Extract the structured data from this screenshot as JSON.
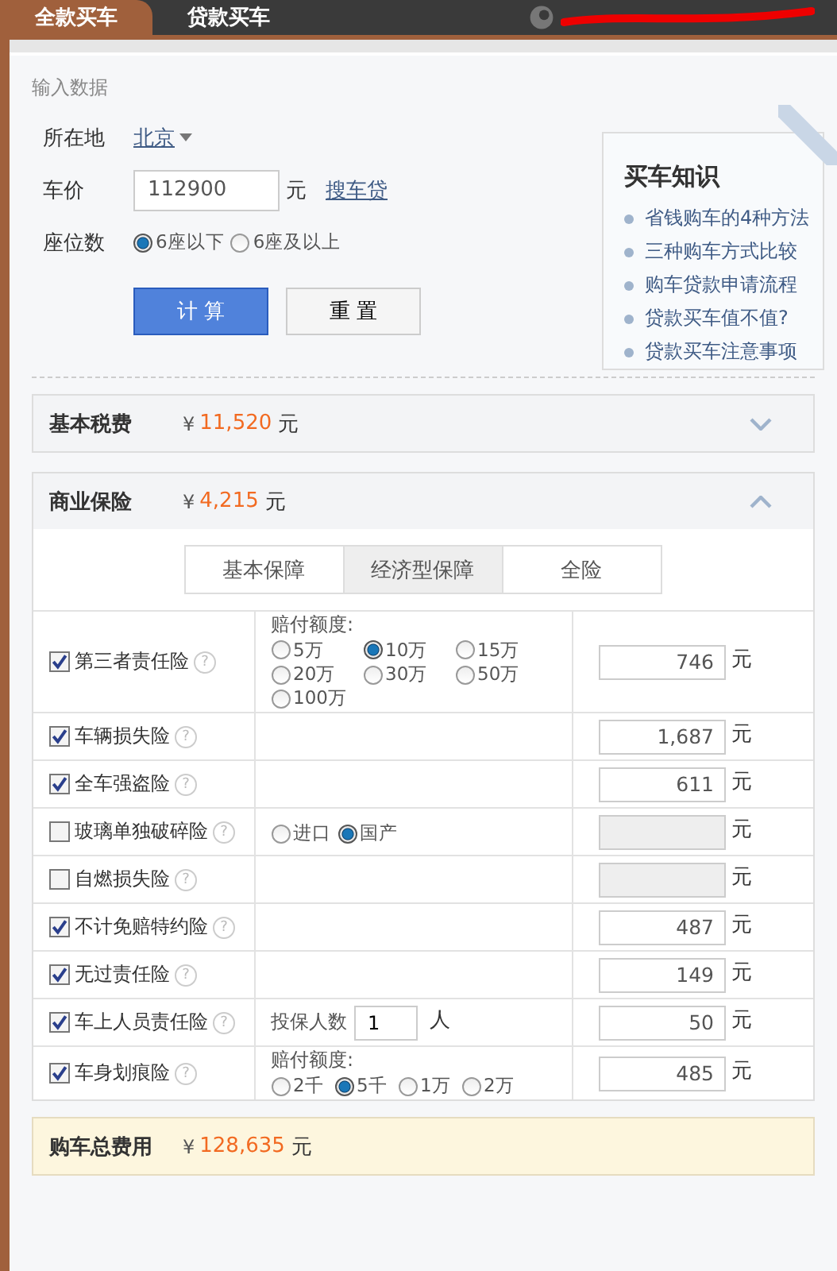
{
  "tabs": [
    {
      "label": "全款买车",
      "selected": true
    },
    {
      "label": "贷款买车",
      "selected": false
    }
  ],
  "input": {
    "section_label": "输入数据",
    "location": {
      "label": "所在地",
      "value": "北京"
    },
    "price": {
      "label": "车价",
      "value": "112900",
      "unit": "元",
      "link": "搜车贷"
    },
    "seats": {
      "label": "座位数",
      "options": [
        {
          "label": "6座以下",
          "selected": true
        },
        {
          "label": "6座及以上",
          "selected": false
        }
      ]
    },
    "buttons": [
      {
        "label": "计 算",
        "kind": "primary"
      },
      {
        "label": "重 置",
        "kind": "secondary"
      }
    ]
  },
  "knowledge": {
    "title": "买车知识",
    "items": [
      "省钱购车的4种方法",
      "三种购车方式比较",
      "购车贷款申请流程",
      "贷款买车值不值?",
      "贷款买车注意事项"
    ]
  },
  "sections": [
    {
      "title": "基本税费",
      "currency": "¥",
      "amount": "11,520",
      "unit": "元",
      "expanded": false
    },
    {
      "title": "商业保险",
      "currency": "¥",
      "amount": "4,215",
      "unit": "元",
      "expanded": true
    }
  ],
  "insurance_tabs": [
    {
      "label": "基本保障",
      "selected": false
    },
    {
      "label": "经济型保障",
      "selected": true
    },
    {
      "label": "全险",
      "selected": false
    }
  ],
  "insurance_rows": [
    {
      "name": "第三者责任险",
      "help": "?",
      "checked": true,
      "detail": {
        "kind": "radios",
        "label": "赔付额度:",
        "options": [
          {
            "label": "5万",
            "selected": false
          },
          {
            "label": "10万",
            "selected": true
          },
          {
            "label": "15万",
            "selected": false
          },
          {
            "label": "20万",
            "selected": false
          },
          {
            "label": "30万",
            "selected": false
          },
          {
            "label": "50万",
            "selected": false
          },
          {
            "label": "100万",
            "selected": false
          }
        ]
      },
      "amount": "746",
      "unit": "元"
    },
    {
      "name": "车辆损失险",
      "help": "?",
      "checked": true,
      "amount": "1,687",
      "unit": "元"
    },
    {
      "name": "全车强盗险",
      "help": "?",
      "checked": true,
      "amount": "611",
      "unit": "元"
    },
    {
      "name": "玻璃单独破碎险",
      "help": "?",
      "checked": false,
      "detail": {
        "kind": "radios",
        "options": [
          {
            "label": "进口",
            "selected": false
          },
          {
            "label": "国产",
            "selected": true
          }
        ]
      },
      "unit": "元"
    },
    {
      "name": "自燃损失险",
      "help": "?",
      "checked": false,
      "unit": "元"
    },
    {
      "name": "不计免赔特约险",
      "help": "?",
      "checked": true,
      "amount": "487",
      "unit": "元"
    },
    {
      "name": "无过责任险",
      "help": "?",
      "checked": true,
      "amount": "149",
      "unit": "元"
    },
    {
      "name": "车上人员责任险",
      "help": "?",
      "checked": true,
      "detail": {
        "kind": "count",
        "label": "投保人数",
        "value": "1",
        "unit": "人"
      },
      "amount": "50",
      "unit": "元"
    },
    {
      "name": "车身划痕险",
      "help": "?",
      "checked": true,
      "detail": {
        "kind": "radios",
        "label": "赔付额度:",
        "options": [
          {
            "label": "2千",
            "selected": false
          },
          {
            "label": "5千",
            "selected": true
          },
          {
            "label": "1万",
            "selected": false
          },
          {
            "label": "2万",
            "selected": false
          }
        ]
      },
      "amount": "485",
      "unit": "元"
    }
  ],
  "total": {
    "label": "购车总费用",
    "currency": "¥",
    "amount": "128,635",
    "unit": "元"
  }
}
